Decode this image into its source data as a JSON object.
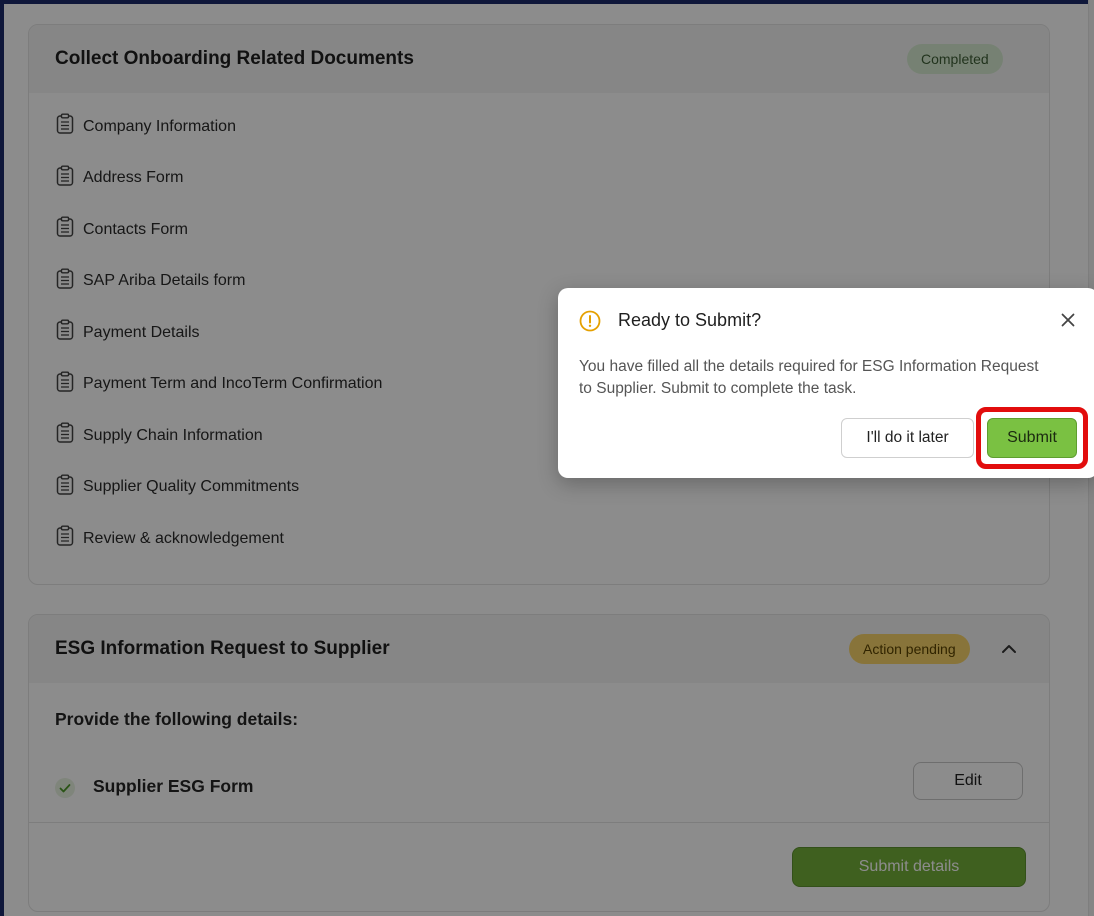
{
  "section1": {
    "title": "Collect Onboarding Related Documents",
    "status": "Completed",
    "items": [
      "Company Information",
      "Address Form",
      "Contacts Form",
      "SAP Ariba Details form",
      "Payment Details",
      "Payment Term and IncoTerm Confirmation",
      "Supply Chain Information",
      "Supplier Quality Commitments",
      "Review & acknowledgement"
    ]
  },
  "section2": {
    "title": "ESG Information Request to Supplier",
    "status": "Action pending",
    "instruction": "Provide the following details:",
    "form_name": "Supplier ESG Form",
    "edit_label": "Edit",
    "submit_details_label": "Submit details"
  },
  "modal": {
    "title": "Ready to Submit?",
    "body": "You have filled all the details required for ESG Information Request to Supplier. Submit to complete the task.",
    "later_label": "I'll do it later",
    "submit_label": "Submit"
  },
  "colors": {
    "frame_border": "#1c2a6b",
    "completed_badge": "#d8ecd2",
    "pending_badge": "#f7d46a",
    "submit_green": "#7ac142",
    "highlight_red": "#e20d0d",
    "warning_icon": "#e5a000"
  }
}
